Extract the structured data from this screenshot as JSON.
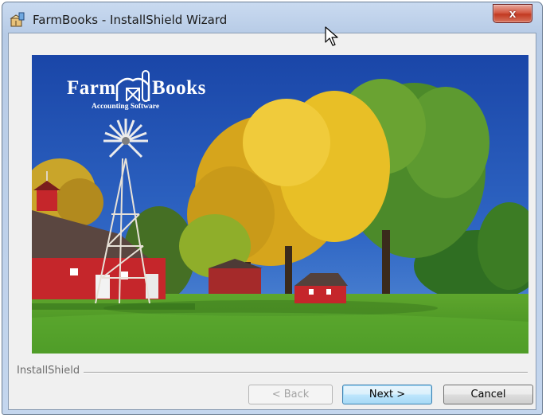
{
  "window": {
    "title": "FarmBooks - InstallShield Wizard",
    "close_symbol": "x",
    "app_icon": "installer-box-icon"
  },
  "banner": {
    "logo_left": "Farm",
    "logo_right": "Books",
    "logo_tagline": "Accounting Software",
    "logo_icon": "barn-logo-icon",
    "scene": "windmill-red-barns-autumn-trees"
  },
  "footer": {
    "brand": "InstallShield"
  },
  "buttons": {
    "back": "< Back",
    "next": "Next >",
    "cancel": "Cancel"
  },
  "colors": {
    "sky": "#1f4fb0",
    "grass": "#4f9a2a",
    "barn_red": "#c5262b",
    "foliage_yellow": "#e3b418",
    "close_red": "#c23a22",
    "default_button_border": "#3c7fb1"
  }
}
